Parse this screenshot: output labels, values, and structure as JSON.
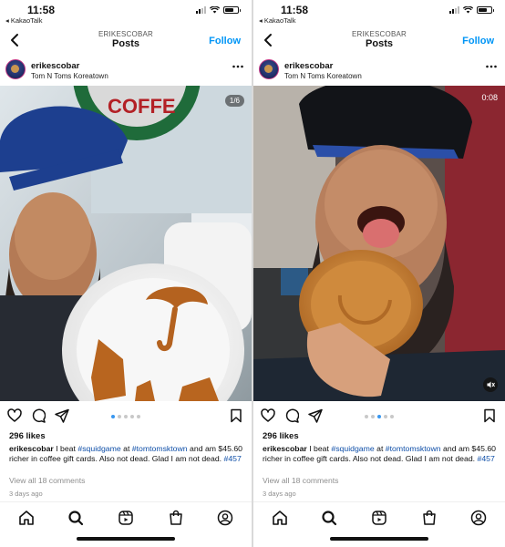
{
  "status": {
    "time": "11:58",
    "back_app": "◂ KakaoTalk"
  },
  "header": {
    "subtitle": "ERIKESCOBAR",
    "title": "Posts",
    "follow": "Follow"
  },
  "posts": [
    {
      "username": "erikescobar",
      "location": "Tom N Toms Koreatown",
      "media_badge": "1/6",
      "likes": "296 likes",
      "caption": {
        "user": "erikescobar",
        "t1": " I beat ",
        "tag1": "#squidgame",
        "t2": " at ",
        "tag2": "#tomtomsktown",
        "t3": " and am $45.60 richer in coffee gift cards. Also not dead. Glad I am not dead. ",
        "tag3": "#457"
      },
      "comments": "View all 18 comments",
      "when": "3 days ago",
      "carousel_active": 0
    },
    {
      "username": "erikescobar",
      "location": "Tom N Toms Koreatown",
      "media_badge": "0:08",
      "likes": "296 likes",
      "caption": {
        "user": "erikescobar",
        "t1": " I beat ",
        "tag1": "#squidgame",
        "t2": " at ",
        "tag2": "#tomtomsktown",
        "t3": " and am $45.60 richer in coffee gift cards. Also not dead. Glad I am not dead. ",
        "tag3": "#457"
      },
      "comments": "View all 18 comments",
      "when": "3 days ago",
      "carousel_active": 2
    }
  ],
  "colors": {
    "accent": "#0095f6",
    "hashtag": "#0f4fa8",
    "muted": "#8e8e8e"
  },
  "icons": [
    "back-chevron-icon",
    "more-icon",
    "heart-icon",
    "comment-icon",
    "share-icon",
    "bookmark-icon",
    "home-icon",
    "search-icon",
    "reels-icon",
    "shop-icon",
    "profile-icon",
    "mute-icon"
  ]
}
